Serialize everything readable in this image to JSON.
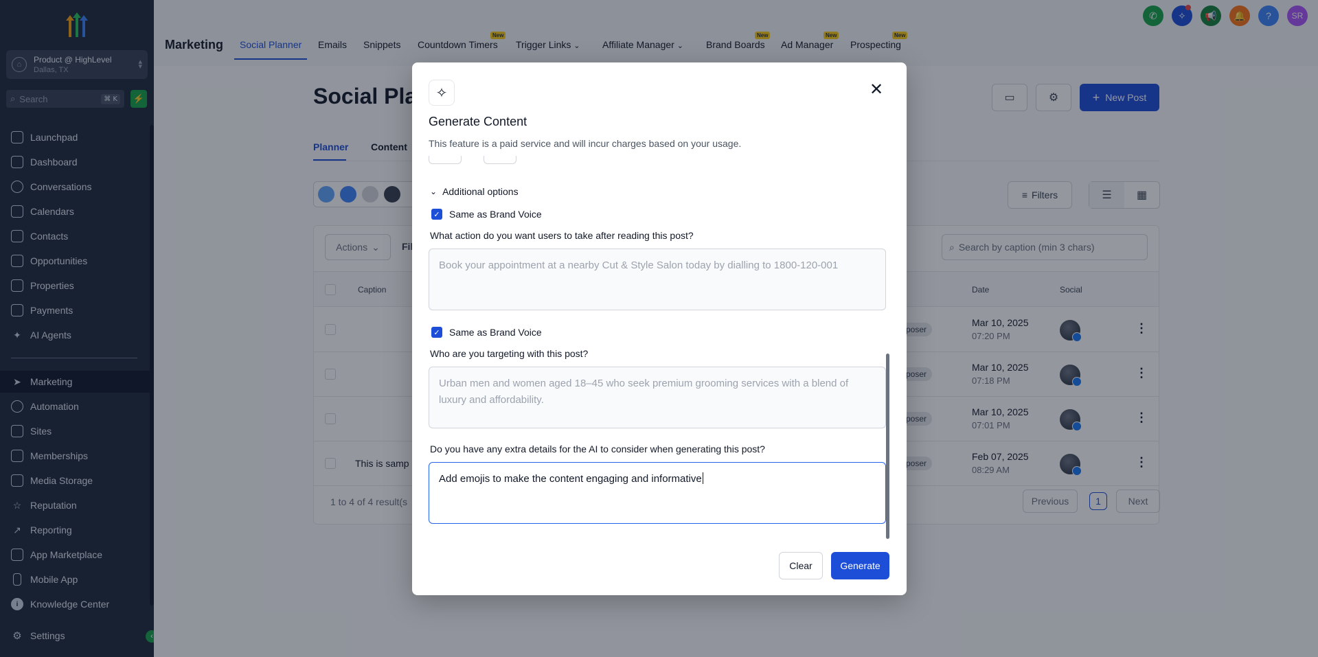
{
  "sidebar": {
    "account": {
      "name": "Product @ HighLevel",
      "location": "Dallas, TX"
    },
    "search": {
      "placeholder": "Search",
      "shortcut": "⌘ K"
    },
    "items": [
      {
        "label": "Launchpad",
        "icon": "rocket-icon"
      },
      {
        "label": "Dashboard",
        "icon": "dashboard-icon"
      },
      {
        "label": "Conversations",
        "icon": "chat-icon"
      },
      {
        "label": "Calendars",
        "icon": "calendar-icon"
      },
      {
        "label": "Contacts",
        "icon": "contacts-icon"
      },
      {
        "label": "Opportunities",
        "icon": "filter-icon"
      },
      {
        "label": "Properties",
        "icon": "home-icon"
      },
      {
        "label": "Payments",
        "icon": "payments-icon"
      },
      {
        "label": "AI Agents",
        "icon": "sparkle-icon"
      },
      {
        "label": "Marketing",
        "icon": "send-icon",
        "active": true
      },
      {
        "label": "Automation",
        "icon": "automation-icon"
      },
      {
        "label": "Sites",
        "icon": "sites-icon"
      },
      {
        "label": "Memberships",
        "icon": "memberships-icon"
      },
      {
        "label": "Media Storage",
        "icon": "media-icon"
      },
      {
        "label": "Reputation",
        "icon": "star-icon"
      },
      {
        "label": "Reporting",
        "icon": "chart-icon"
      },
      {
        "label": "App Marketplace",
        "icon": "grid-icon"
      },
      {
        "label": "Mobile App",
        "icon": "mobile-icon"
      },
      {
        "label": "Knowledge Center",
        "icon": "info-icon"
      },
      {
        "label": "Settings",
        "icon": "gear-icon"
      }
    ]
  },
  "topbar": {
    "title": "Marketing",
    "tabs": [
      {
        "label": "Social Planner",
        "active": true
      },
      {
        "label": "Emails"
      },
      {
        "label": "Snippets"
      },
      {
        "label": "Countdown Timers",
        "badge": "New"
      },
      {
        "label": "Trigger Links"
      },
      {
        "label": "Affiliate Manager"
      },
      {
        "label": "Brand Boards",
        "badge": "New"
      },
      {
        "label": "Ad Manager",
        "badge": "New"
      },
      {
        "label": "Prospecting",
        "badge": "New"
      }
    ],
    "user_initials": "SR",
    "help": "?"
  },
  "page": {
    "title": "Social Plan",
    "new_post": "New Post",
    "subtabs": [
      "Planner",
      "Content"
    ],
    "filters": "Filters",
    "actions": "Actions",
    "filter_partial": "Fil",
    "search_placeholder": "Search by caption (min 3 chars)",
    "columns": {
      "caption": "Caption",
      "date": "Date",
      "social": "Social"
    },
    "rows": [
      {
        "caption": "",
        "status": "poser",
        "date": "Mar 10, 2025",
        "time": "07:20 PM"
      },
      {
        "caption": "",
        "status": "poser",
        "date": "Mar 10, 2025",
        "time": "07:18 PM"
      },
      {
        "caption": "",
        "status": "poser",
        "date": "Mar 10, 2025",
        "time": "07:01 PM"
      },
      {
        "caption": "This is samp",
        "status": "poser",
        "date": "Feb 07, 2025",
        "time": "08:29 AM"
      }
    ],
    "pager": {
      "summary": "1 to 4 of 4 result(s",
      "previous": "Previous",
      "page": "1",
      "next": "Next"
    }
  },
  "modal": {
    "title": "Generate Content",
    "description": "This feature is a paid service and will incur charges based on your usage.",
    "additional_options": "Additional options",
    "brand_voice_1": "Same as Brand Voice",
    "q_action": "What action do you want users to take after reading this post?",
    "action_placeholder": "Book your appointment at a nearby Cut & Style Salon today by dialling to 1800-120-001",
    "brand_voice_2": "Same as Brand Voice",
    "q_target": "Who are you targeting with this post?",
    "target_placeholder": "Urban men and women aged 18–45 who seek premium grooming services with a blend of luxury and affordability.",
    "q_extra": "Do you have any extra details for the AI to consider when generating this post?",
    "extra_value": "Add emojis to make the content engaging and informative",
    "clear": "Clear",
    "generate": "Generate"
  },
  "colors": {
    "primary": "#1d4ed8",
    "sidebar": "#1e293b",
    "accent_green": "#16a34a"
  }
}
